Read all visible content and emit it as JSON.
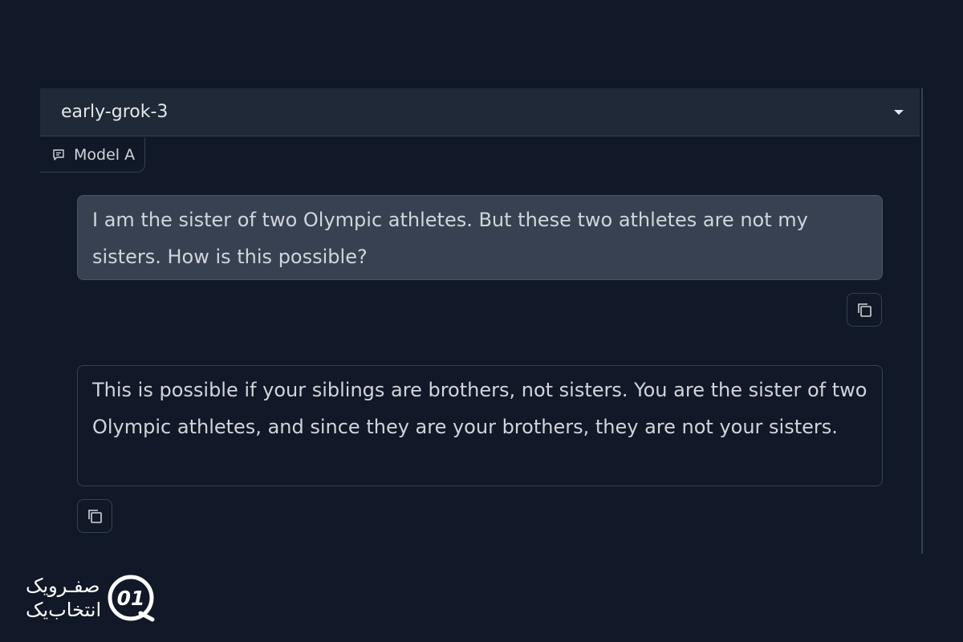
{
  "model_selector": {
    "value": "early-grok-3"
  },
  "model_tag": {
    "label": "Model A",
    "icon": "chat-bubble-icon"
  },
  "messages": [
    {
      "role": "user",
      "text": "I am the sister of two Olympic athletes. But these two athletes are not my sisters. How is this possible?"
    },
    {
      "role": "assistant",
      "text": "This is possible if your siblings are brothers, not sisters. You are the sister of two Olympic athletes, and since they are your brothers, they are not your sisters."
    }
  ],
  "copy_icon": "copy-icon",
  "watermark": {
    "line1": "صفـرویک",
    "line2": "انتخاب‌یک",
    "mark": "01"
  },
  "colors": {
    "background": "#111827",
    "panel": "#1f2937",
    "user_bubble": "#374151",
    "border": "#374151",
    "text": "#d1d5db"
  }
}
